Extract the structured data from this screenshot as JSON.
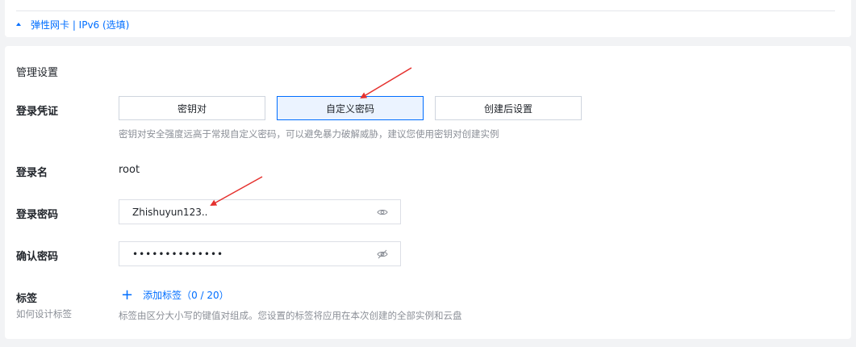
{
  "top_section": {
    "toggle_label": "弹性网卡 | IPv6 (选填)"
  },
  "management": {
    "title": "管理设置",
    "credential": {
      "label": "登录凭证",
      "options": [
        "密钥对",
        "自定义密码",
        "创建后设置"
      ],
      "selected": "自定义密码",
      "hint": "密钥对安全强度远高于常规自定义密码，可以避免暴力破解威胁，建议您使用密钥对创建实例"
    },
    "login_name": {
      "label": "登录名",
      "value": "root"
    },
    "password": {
      "label": "登录密码",
      "value": "Zhishuyun123..",
      "icon": "eye-icon"
    },
    "confirm_password": {
      "label": "确认密码",
      "value": "••••••••••••••",
      "icon": "eye-off-icon"
    },
    "tags": {
      "label": "标签",
      "help_link": "如何设计标签",
      "add_label": "添加标签（0 / 20）",
      "hint": "标签由区分大小写的键值对组成。您设置的标签将应用在本次创建的全部实例和云盘"
    }
  },
  "colors": {
    "accent": "#006eff",
    "annotation_arrow": "#e5312e"
  }
}
